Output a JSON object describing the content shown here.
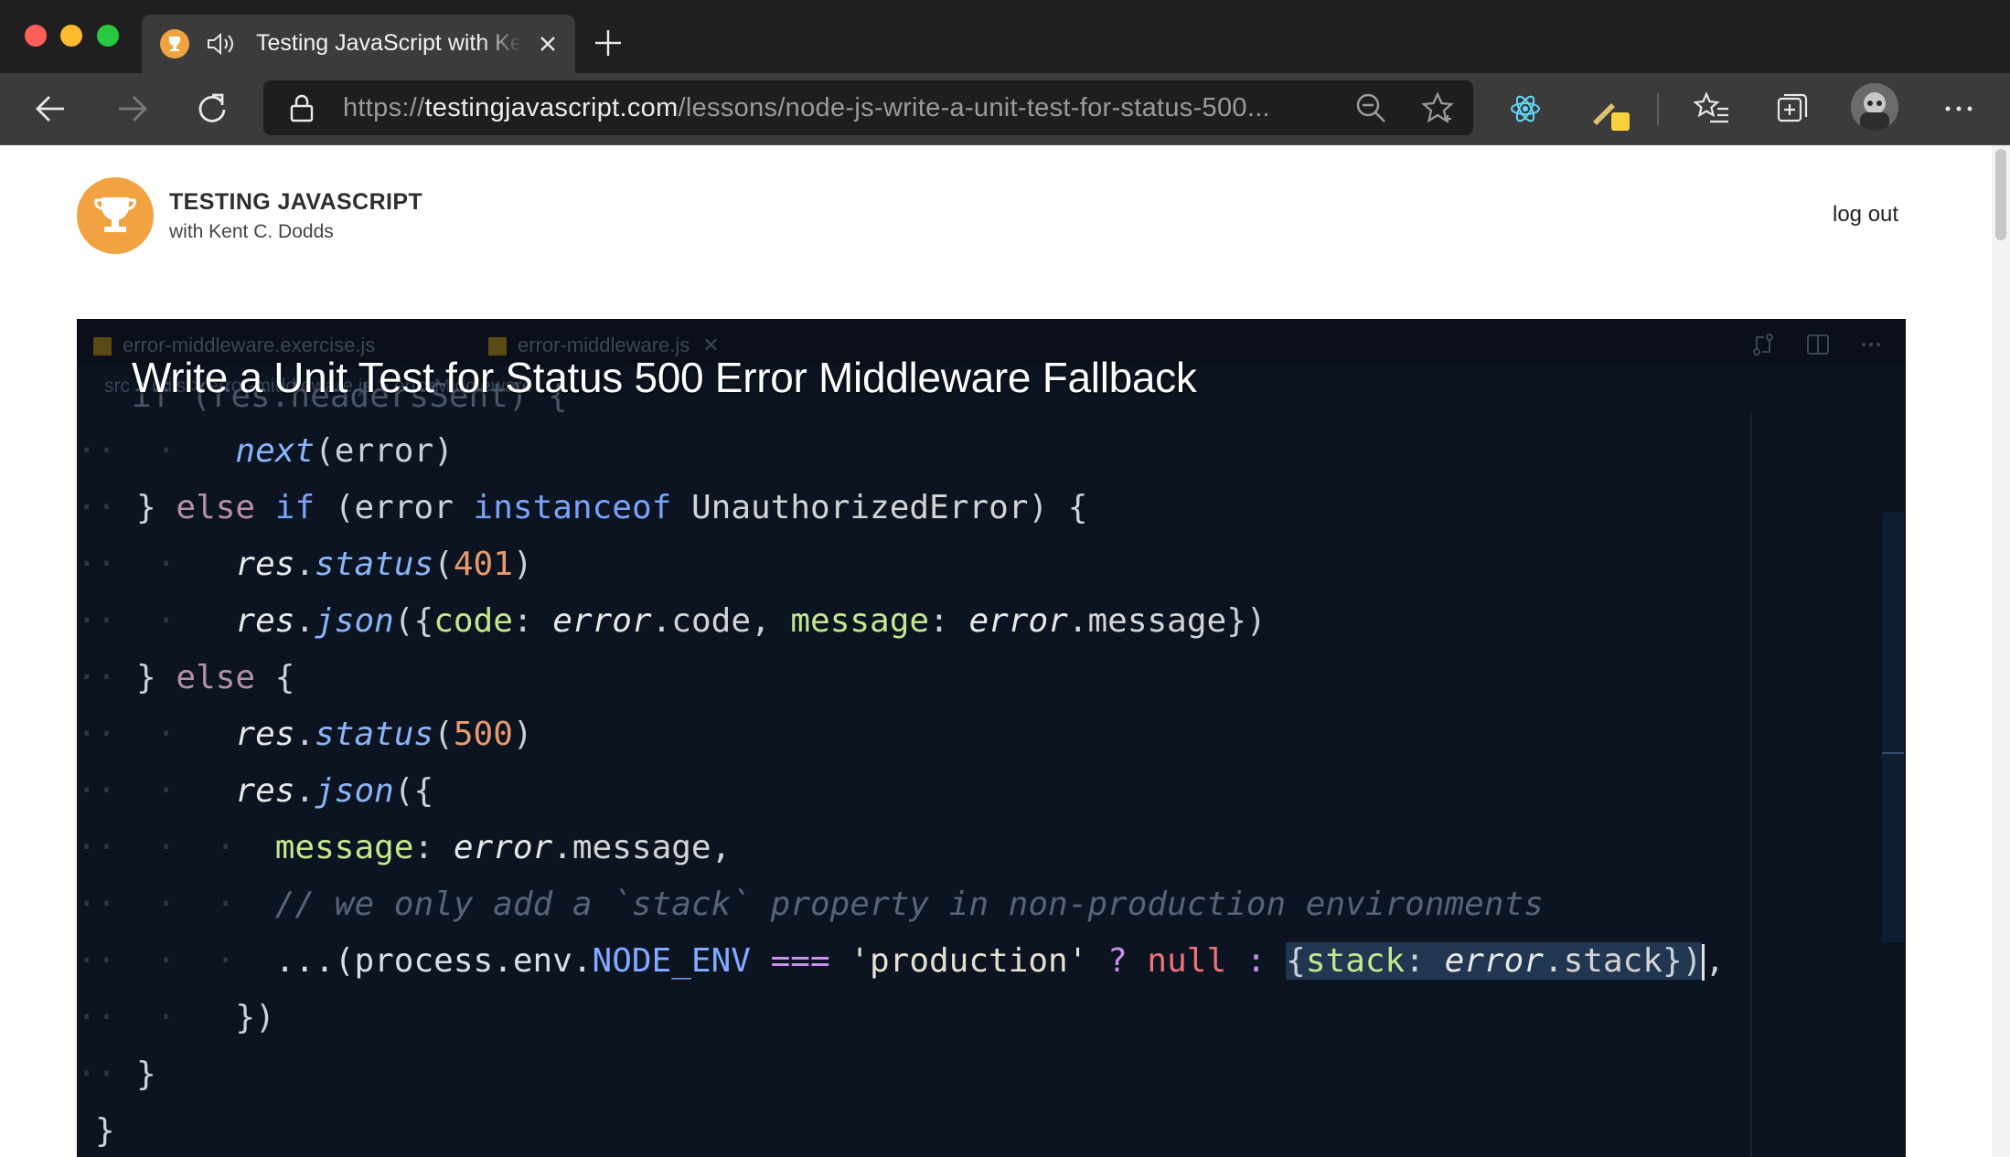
{
  "browser": {
    "tab_title": "Testing JavaScript with Kent C. Dodds",
    "url_scheme": "https://",
    "url_host": "testingjavascript.com",
    "url_path": "/lessons/node-js-write-a-unit-test-for-status-500..."
  },
  "site": {
    "brand_title": "TESTING JAVASCRIPT",
    "brand_subtitle": "with Kent C. Dodds",
    "logout_label": "log out"
  },
  "video": {
    "title": "Write a Unit Test for Status 500 Error Middleware Fallback",
    "editor_tabs": [
      "error-middleware.exercise.js",
      "error-middleware.js"
    ],
    "breadcrumb": "src > utils > error-middleware.js > errorMiddleware",
    "code": {
      "l0": "if (res.headersSent) {",
      "l1_fn": "next",
      "l1_arg": "(error)",
      "l2_a": "} ",
      "l2_else": "else",
      "l2_if": "if",
      "l2_b": " (error ",
      "l2_inst": "instanceof",
      "l2_cls": " UnauthorizedError",
      "l2_c": ") {",
      "l3_obj": "res",
      "l3_m": "status",
      "l3_num": "401",
      "l4_obj": "res",
      "l4_m": "json",
      "l4_k1": "code",
      "l4_v1": "error",
      "l4_p1": ".code",
      "l4_k2": "message",
      "l4_v2": "error",
      "l4_p2": ".message",
      "l5_a": "} ",
      "l5_else": "else",
      "l5_b": " {",
      "l6_obj": "res",
      "l6_m": "status",
      "l6_num": "500",
      "l7_obj": "res",
      "l7_m": "json",
      "l8_k": "message",
      "l8_v": "error",
      "l8_p": ".message,",
      "l9_cmt": "// we only add a `stack` property in non-production environments",
      "l10_a": "...(process.env.",
      "l10_const": "NODE_ENV",
      "l10_op": " === ",
      "l10_str": "'production'",
      "l10_q": " ? ",
      "l10_null": "null",
      "l10_c": " : ",
      "l10_sel_k": "stack",
      "l10_sel_v": "error",
      "l10_sel_p": ".stack",
      "l10_end": ",",
      "l11": "})",
      "l12": "}",
      "l13": "}"
    }
  },
  "colors": {
    "brand_orange": "#f0a340",
    "editor_bg": "#0c1421",
    "browser_chrome": "#3b3b3b"
  }
}
